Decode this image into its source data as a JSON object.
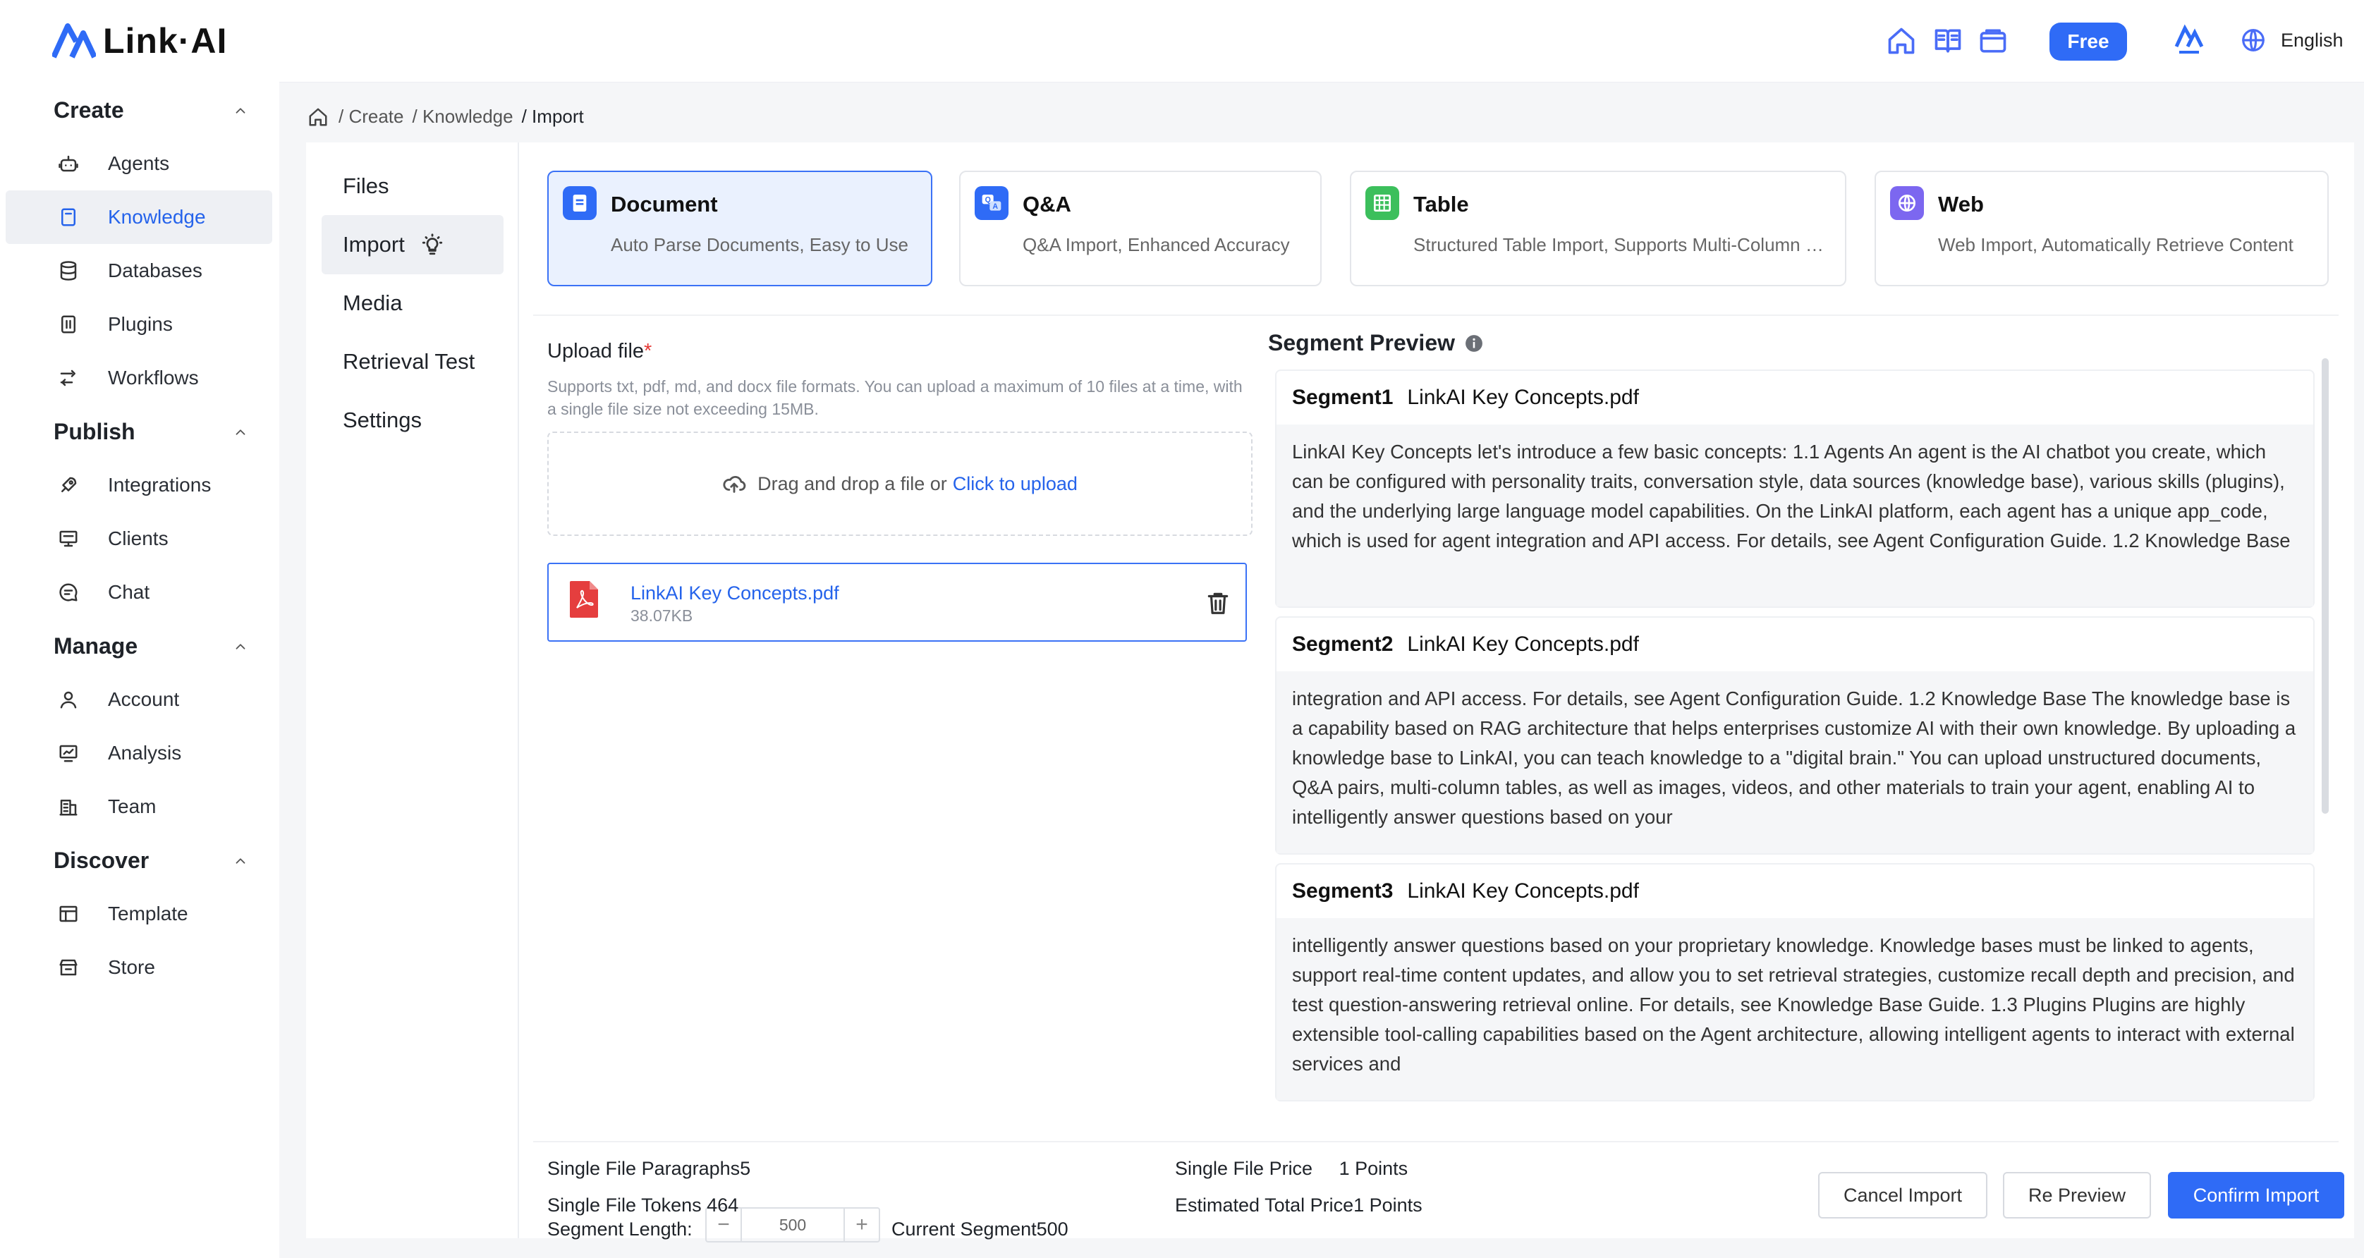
{
  "header": {
    "logo_text": "Link·AI",
    "free_label": "Free",
    "language": "English",
    "icons": [
      "home-icon",
      "book-icon",
      "wallet-icon",
      "avatar",
      "globe-icon"
    ],
    "accent_color": "#2f6bf6"
  },
  "sidebar": {
    "sections": [
      {
        "title": "Create",
        "items": [
          "Agents",
          "Knowledge",
          "Databases",
          "Plugins",
          "Workflows"
        ]
      },
      {
        "title": "Publish",
        "items": [
          "Integrations",
          "Clients",
          "Chat"
        ]
      },
      {
        "title": "Manage",
        "items": [
          "Account",
          "Analysis",
          "Team"
        ]
      },
      {
        "title": "Discover",
        "items": [
          "Template",
          "Store"
        ]
      }
    ],
    "active_item": "Knowledge"
  },
  "breadcrumb": [
    "/ Create",
    "/ Knowledge",
    "/ Import"
  ],
  "subnav": {
    "items": [
      "Files",
      "Import",
      "Media",
      "Retrieval Test",
      "Settings"
    ],
    "active": "Import"
  },
  "import_types": [
    {
      "title": "Document",
      "desc": "Auto Parse Documents, Easy to Use",
      "active": true
    },
    {
      "title": "Q&A",
      "desc": "Q&A Import, Enhanced Accuracy",
      "active": false
    },
    {
      "title": "Table",
      "desc": "Structured Table Import, Supports Multi-Column Data",
      "active": false
    },
    {
      "title": "Web",
      "desc": "Web Import, Automatically Retrieve Content",
      "active": false
    }
  ],
  "upload": {
    "label": "Upload file",
    "required_mark": "*",
    "hint": "Supports txt, pdf, md, and docx file formats. You can upload a maximum of 10 files at a time, with a single file size not exceeding 15MB.",
    "drop_text": "Drag and drop a file or",
    "click_text": "Click to upload",
    "file": {
      "name": "LinkAI Key Concepts.pdf",
      "size": "38.07KB"
    }
  },
  "segment": {
    "length_label": "Segment Length:",
    "minus": "−",
    "plus": "+",
    "value": "500",
    "current": "Current Segment500"
  },
  "preview": {
    "title": "Segment Preview",
    "segments": [
      {
        "label": "Segment1",
        "file": "LinkAI Key Concepts.pdf",
        "text": "LinkAI Key Concepts let's introduce a few basic concepts: 1.1 Agents An agent is the AI chatbot you create, which can be configured with personality traits, conversation style, data sources (knowledge base), various skills (plugins), and the underlying large language model capabilities. On the LinkAI platform, each agent has a unique app_code, which is used for agent integration and API access. For details, see Agent Configuration Guide. 1.2 Knowledge Base"
      },
      {
        "label": "Segment2",
        "file": "LinkAI Key Concepts.pdf",
        "text": "integration and API access. For details, see Agent Configuration Guide. 1.2 Knowledge Base The knowledge base is a capability based on RAG architecture that helps enterprises customize AI with their own knowledge. By uploading a knowledge base to LinkAI, you can teach knowledge to a \"digital brain.\" You can upload unstructured documents, Q&A pairs, multi-column tables, as well as images, videos, and other materials to train your agent, enabling AI to intelligently answer questions based on your"
      },
      {
        "label": "Segment3",
        "file": "LinkAI Key Concepts.pdf",
        "text": "intelligently answer questions based on your proprietary knowledge. Knowledge bases must be linked to agents, support real-time content updates, and allow you to set retrieval strategies, customize recall depth and precision, and test question-answering retrieval online. For details, see Knowledge Base Guide. 1.3 Plugins Plugins are highly extensible tool-calling capabilities based on the Agent architecture, allowing intelligent agents to interact with external services and"
      }
    ]
  },
  "footer": {
    "paragraphs": "Single File Paragraphs5",
    "tokens": "Single File Tokens 464",
    "price": "Single File Price     1 Points",
    "total": "Estimated Total Price1 Points",
    "cancel": "Cancel Import",
    "repreview": "Re Preview",
    "confirm": "Confirm Import"
  }
}
